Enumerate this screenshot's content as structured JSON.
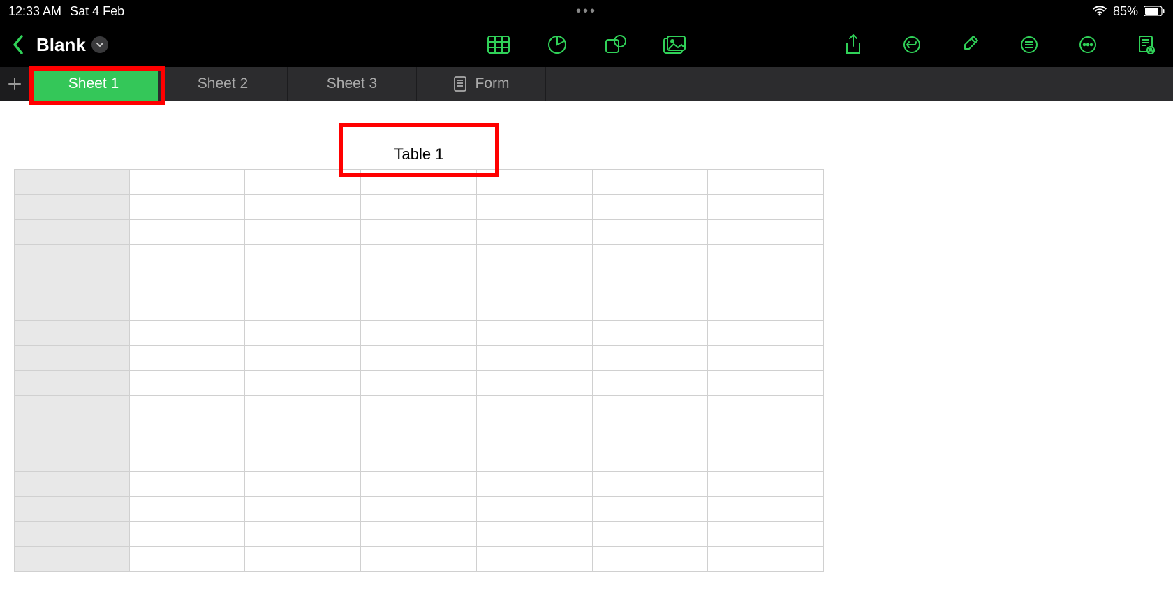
{
  "status": {
    "time": "12:33 AM",
    "date": "Sat 4 Feb",
    "battery": "85%"
  },
  "header": {
    "doc_title": "Blank"
  },
  "tabs": [
    {
      "label": "Sheet 1",
      "active": true
    },
    {
      "label": "Sheet 2",
      "active": false
    },
    {
      "label": "Sheet 3",
      "active": false
    },
    {
      "label": "Form",
      "active": false,
      "icon": "form"
    }
  ],
  "table": {
    "title": "Table 1",
    "columns": 7,
    "rows": 15
  },
  "colors": {
    "accent": "#30d158",
    "active_tab": "#34c759",
    "highlight": "#ff0000"
  }
}
